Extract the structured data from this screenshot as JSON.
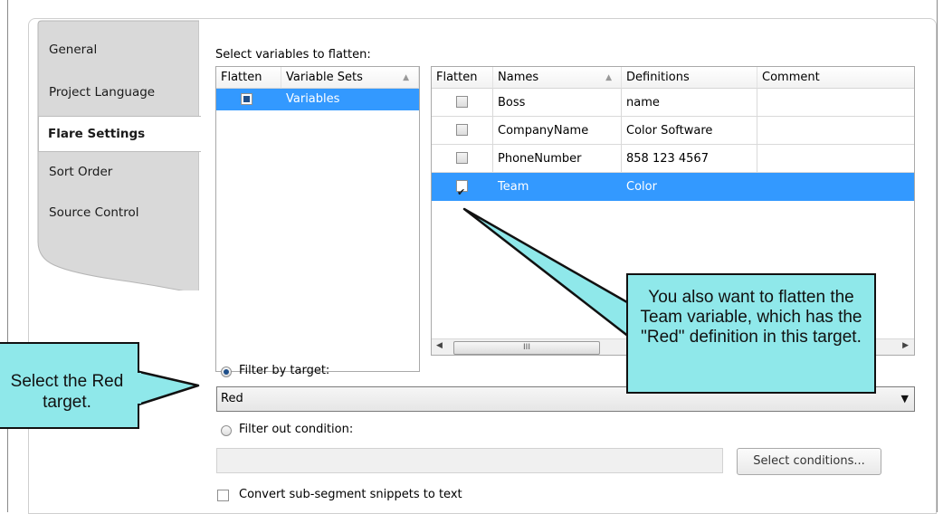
{
  "sidebar": {
    "items": [
      {
        "label": "General",
        "active": false
      },
      {
        "label": "Project Language",
        "active": false
      },
      {
        "label": "Flare Settings",
        "active": true
      },
      {
        "label": "Sort Order",
        "active": false
      },
      {
        "label": "Source Control",
        "active": false
      }
    ]
  },
  "main": {
    "section_label": "Select variables to flatten:",
    "sets_table": {
      "headers": [
        "Flatten",
        "Variable Sets"
      ],
      "rows": [
        {
          "flatten": "partial",
          "name": "Variables",
          "selected": true
        }
      ]
    },
    "vars_table": {
      "headers": [
        "Flatten",
        "Names",
        "Definitions",
        "Comment"
      ],
      "rows": [
        {
          "flatten": false,
          "name": "Boss",
          "definition": "name",
          "comment": "",
          "selected": false
        },
        {
          "flatten": false,
          "name": "CompanyName",
          "definition": "Color Software",
          "comment": "",
          "selected": false
        },
        {
          "flatten": false,
          "name": "PhoneNumber",
          "definition": "858 123 4567",
          "comment": "",
          "selected": false
        },
        {
          "flatten": true,
          "name": "Team",
          "definition": "Color",
          "comment": "",
          "selected": true
        }
      ],
      "scrollbar_grip": "III"
    },
    "filter_target_label": "Filter by target:",
    "filter_target_value": "Red",
    "filter_out_label": "Filter out condition:",
    "filter_out_value": "",
    "select_conditions_label": "Select conditions...",
    "convert_label": "Convert sub-segment snippets to text"
  },
  "callouts": {
    "left": "Select the Red target.",
    "right": "You also want to flatten the Team variable, which has the \"Red\" definition in this target."
  },
  "colors": {
    "selection": "#3399ff",
    "callout_fill": "#8fe8ea"
  }
}
